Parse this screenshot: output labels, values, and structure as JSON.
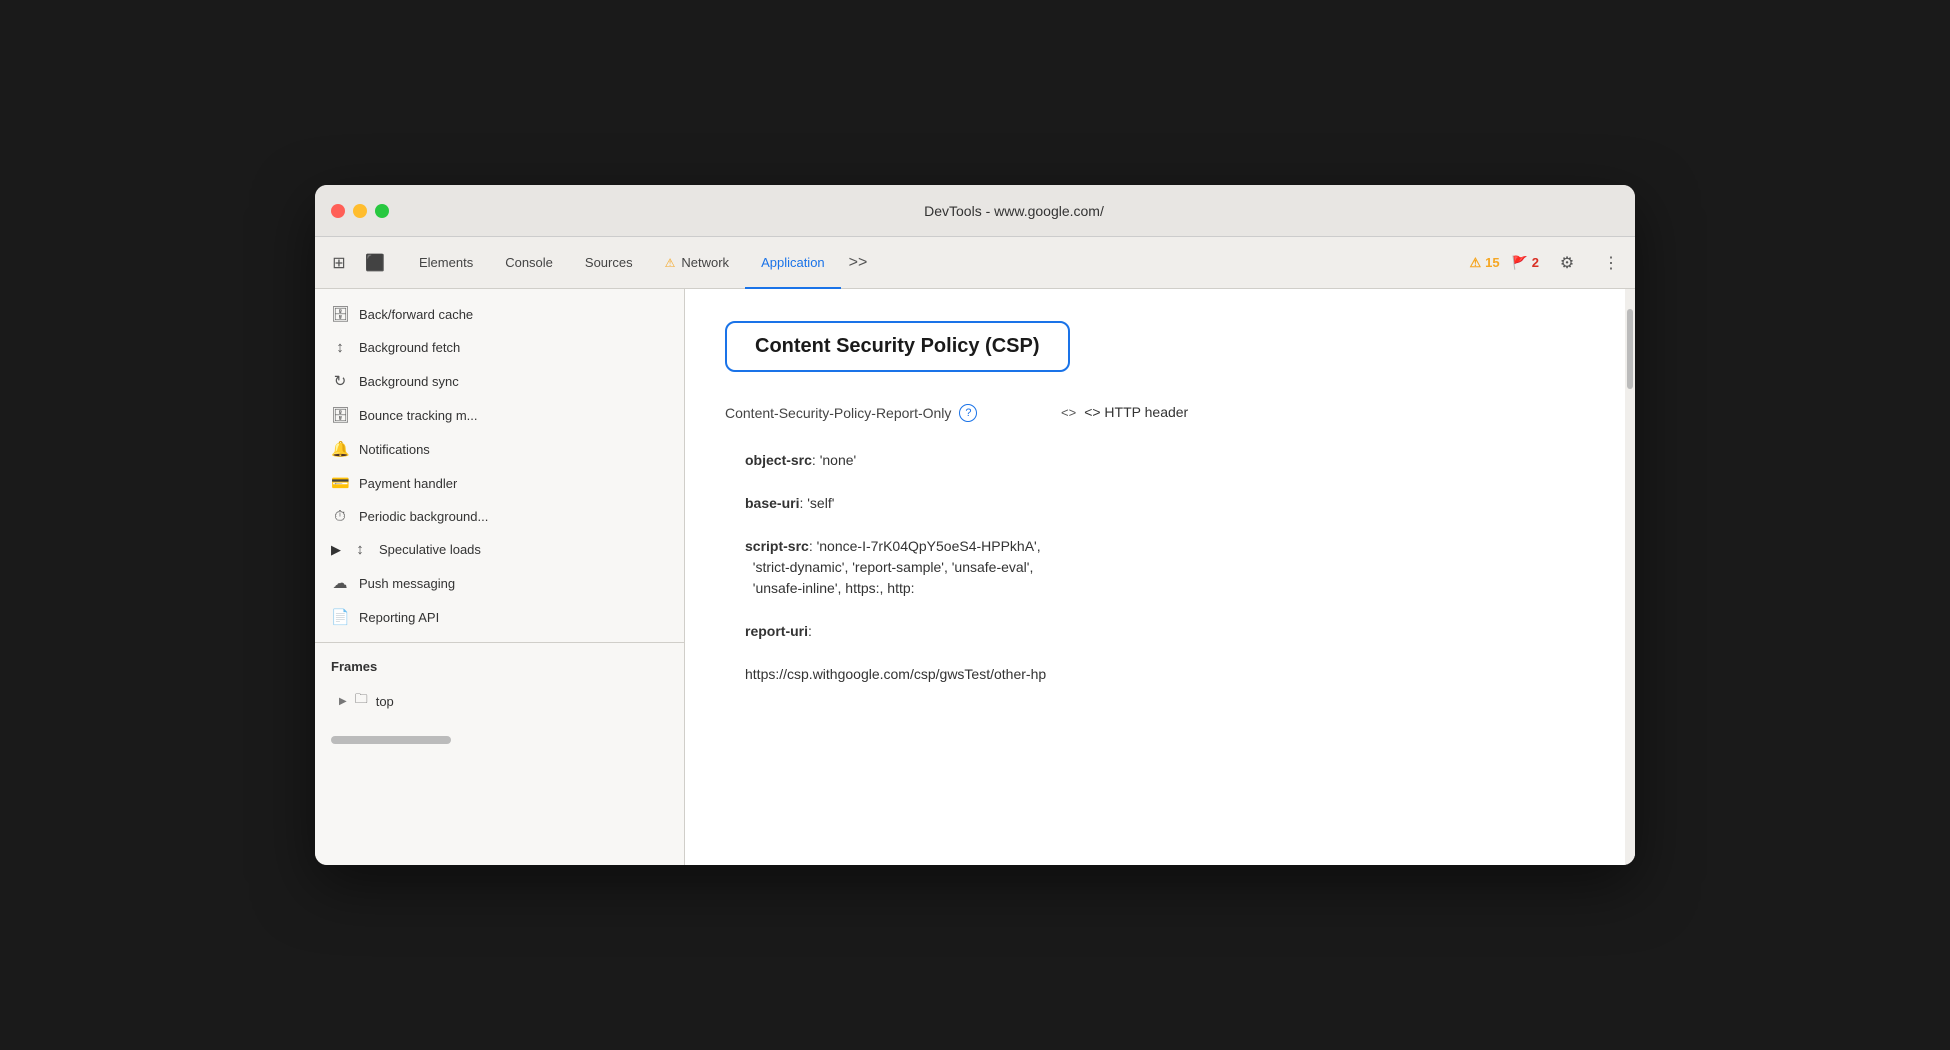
{
  "window": {
    "title": "DevTools - www.google.com/"
  },
  "tabs": {
    "elements": "Elements",
    "console": "Console",
    "sources": "Sources",
    "network": "Network",
    "application": "Application",
    "more": ">>",
    "warnings_count": "15",
    "errors_count": "2"
  },
  "sidebar": {
    "items": [
      {
        "label": "Back/forward cache",
        "icon": "🗄"
      },
      {
        "label": "Background fetch",
        "icon": "↕"
      },
      {
        "label": "Background sync",
        "icon": "↻"
      },
      {
        "label": "Bounce tracking m...",
        "icon": "🗄"
      },
      {
        "label": "Notifications",
        "icon": "🔔"
      },
      {
        "label": "Payment handler",
        "icon": "💳"
      },
      {
        "label": "Periodic background...",
        "icon": "⏱"
      },
      {
        "label": "Speculative loads",
        "icon": "↕",
        "expandable": true
      },
      {
        "label": "Push messaging",
        "icon": "☁"
      },
      {
        "label": "Reporting API",
        "icon": "📄"
      }
    ],
    "frames_section": {
      "header": "Frames",
      "items": [
        {
          "label": "top",
          "expandable": true
        }
      ]
    }
  },
  "content": {
    "csp_title": "Content Security Policy (CSP)",
    "policy_key": "Content-Security-Policy-Report-Only",
    "policy_source": "<> HTTP header",
    "details": [
      {
        "key": "object-src",
        "value": "'none'"
      },
      {
        "key": "base-uri",
        "value": "'self'"
      },
      {
        "key": "script-src",
        "value": "'nonce-I-7rK04QpY5oeS4-HPPkhA', 'strict-dynamic', 'report-sample', 'unsafe-eval', 'unsafe-inline', https:, http:"
      },
      {
        "key": "report-uri",
        "value": ""
      },
      {
        "key": "report_uri_url",
        "value": "https://csp.withgoogle.com/csp/gwsTest/other-hp"
      }
    ]
  }
}
